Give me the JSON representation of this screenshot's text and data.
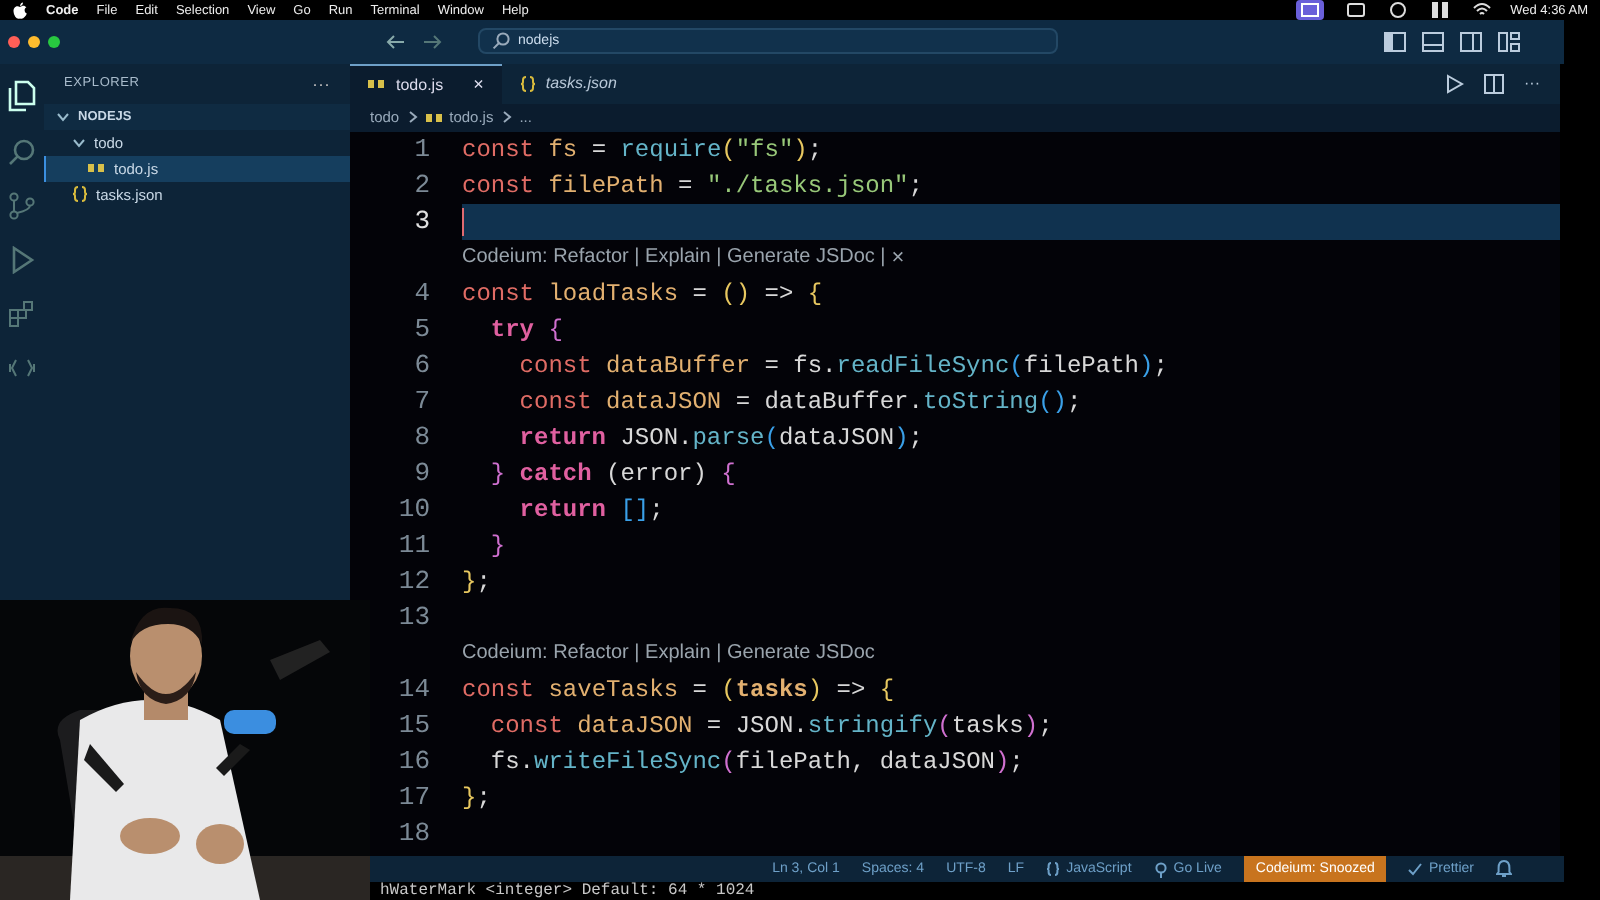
{
  "menu_bar": {
    "items": [
      {
        "label": "Code",
        "bold": true
      },
      {
        "label": "File",
        "bold": false
      },
      {
        "label": "Edit",
        "bold": false
      },
      {
        "label": "Selection",
        "bold": false
      },
      {
        "label": "View",
        "bold": false
      },
      {
        "label": "Go",
        "bold": false
      },
      {
        "label": "Run",
        "bold": false
      },
      {
        "label": "Terminal",
        "bold": false
      },
      {
        "label": "Window",
        "bold": false
      },
      {
        "label": "Help",
        "bold": false
      }
    ],
    "clock": "Wed 4:36 AM"
  },
  "title_bar": {
    "search": "nodejs"
  },
  "explorer": {
    "title": "EXPLORER",
    "more": "···",
    "root": {
      "label": "NODEJS",
      "expanded": true,
      "children": [
        {
          "label": "todo",
          "kind": "folder",
          "expanded": true,
          "selected": false,
          "children": [
            {
              "label": "todo.js",
              "kind": "js",
              "selected": true
            }
          ]
        },
        {
          "label": "tasks.json",
          "kind": "json",
          "selected": false
        }
      ]
    }
  },
  "tabs": [
    {
      "label": "todo.js",
      "kind": "js",
      "selected": true,
      "close": "×"
    },
    {
      "label": "tasks.json",
      "kind": "json",
      "selected": false
    }
  ],
  "breadcrumbs": [
    {
      "label": "todo",
      "kind": "folder"
    },
    {
      "label": "todo.js",
      "kind": "js"
    },
    {
      "label": "...",
      "kind": "more"
    }
  ],
  "editor": {
    "lines": [
      {
        "kind": "code",
        "number": "1",
        "current": false,
        "tokens": [
          {
            "kind": "kw",
            "text": "const"
          },
          {
            "kind": "var",
            "text": " fs"
          },
          {
            "kind": "op",
            "text": " = "
          },
          {
            "kind": "fn",
            "text": "require"
          },
          {
            "kind": "br",
            "text": "("
          },
          {
            "kind": "str",
            "text": "\"fs\""
          },
          {
            "kind": "br",
            "text": ")"
          },
          {
            "kind": "op",
            "text": ";"
          }
        ]
      },
      {
        "kind": "code",
        "number": "2",
        "current": false,
        "tokens": [
          {
            "kind": "kw",
            "text": "const"
          },
          {
            "kind": "var",
            "text": " filePath"
          },
          {
            "kind": "op",
            "text": " = "
          },
          {
            "kind": "str",
            "text": "\"./tasks.json\""
          },
          {
            "kind": "op",
            "text": ";"
          }
        ]
      },
      {
        "kind": "code",
        "number": "3",
        "current": true
      },
      {
        "kind": "lens",
        "text": "Codeium: Refactor | Explain | Generate JSDoc |",
        "close": "×"
      },
      {
        "kind": "code",
        "number": "4",
        "current": false,
        "tokens": [
          {
            "kind": "kw",
            "text": "const"
          },
          {
            "kind": "var",
            "text": " loadTasks"
          },
          {
            "kind": "op",
            "text": " = "
          },
          {
            "kind": "br",
            "text": "()"
          },
          {
            "kind": "op",
            "text": " => "
          },
          {
            "kind": "br",
            "text": "{"
          }
        ]
      },
      {
        "kind": "code",
        "number": "5",
        "current": false,
        "tokens": [
          {
            "kind": "ctl",
            "text": "  try"
          },
          {
            "kind": "br2",
            "text": " {"
          }
        ]
      },
      {
        "kind": "code",
        "number": "6",
        "current": false,
        "tokens": [
          {
            "kind": "kw",
            "text": "    const"
          },
          {
            "kind": "var",
            "text": " dataBuffer"
          },
          {
            "kind": "op",
            "text": " = "
          },
          {
            "kind": "plain",
            "text": "fs."
          },
          {
            "kind": "fn",
            "text": "readFileSync"
          },
          {
            "kind": "br3",
            "text": "("
          },
          {
            "kind": "plain",
            "text": "filePath"
          },
          {
            "kind": "br3",
            "text": ")"
          },
          {
            "kind": "op",
            "text": ";"
          }
        ]
      },
      {
        "kind": "code",
        "number": "7",
        "current": false,
        "tokens": [
          {
            "kind": "kw",
            "text": "    const"
          },
          {
            "kind": "var",
            "text": " dataJSON"
          },
          {
            "kind": "op",
            "text": " = "
          },
          {
            "kind": "plain",
            "text": "dataBuffer."
          },
          {
            "kind": "fn",
            "text": "toString"
          },
          {
            "kind": "br3",
            "text": "()"
          },
          {
            "kind": "op",
            "text": ";"
          }
        ]
      },
      {
        "kind": "code",
        "number": "8",
        "current": false,
        "tokens": [
          {
            "kind": "ctl",
            "text": "    return"
          },
          {
            "kind": "plain",
            "text": " JSON."
          },
          {
            "kind": "fn",
            "text": "parse"
          },
          {
            "kind": "br3",
            "text": "("
          },
          {
            "kind": "plain",
            "text": "dataJSON"
          },
          {
            "kind": "br3",
            "text": ")"
          },
          {
            "kind": "op",
            "text": ";"
          }
        ]
      },
      {
        "kind": "code",
        "number": "9",
        "current": false,
        "tokens": [
          {
            "kind": "br2",
            "text": "  }"
          },
          {
            "kind": "ctl",
            "text": " catch"
          },
          {
            "kind": "plain",
            "text": " (error) "
          },
          {
            "kind": "br2",
            "text": "{"
          }
        ]
      },
      {
        "kind": "code",
        "number": "10",
        "current": false,
        "tokens": [
          {
            "kind": "ctl",
            "text": "    return"
          },
          {
            "kind": "br3",
            "text": " []"
          },
          {
            "kind": "op",
            "text": ";"
          }
        ]
      },
      {
        "kind": "code",
        "number": "11",
        "current": false,
        "tokens": [
          {
            "kind": "br2",
            "text": "  }"
          }
        ]
      },
      {
        "kind": "code",
        "number": "12",
        "current": false,
        "tokens": [
          {
            "kind": "br",
            "text": "}"
          },
          {
            "kind": "op",
            "text": ";"
          }
        ]
      },
      {
        "kind": "code",
        "number": "13",
        "current": false
      },
      {
        "kind": "lens",
        "text": "Codeium: Refactor | Explain | Generate JSDoc"
      },
      {
        "kind": "code",
        "number": "14",
        "current": false,
        "tokens": [
          {
            "kind": "kw",
            "text": "const"
          },
          {
            "kind": "var",
            "text": " saveTasks"
          },
          {
            "kind": "op",
            "text": " = "
          },
          {
            "kind": "br",
            "text": "("
          },
          {
            "kind": "param",
            "text": "tasks"
          },
          {
            "kind": "br",
            "text": ")"
          },
          {
            "kind": "op",
            "text": " => "
          },
          {
            "kind": "br",
            "text": "{"
          }
        ]
      },
      {
        "kind": "code",
        "number": "15",
        "current": false,
        "tokens": [
          {
            "kind": "kw",
            "text": "  const"
          },
          {
            "kind": "var",
            "text": " dataJSON"
          },
          {
            "kind": "op",
            "text": " = "
          },
          {
            "kind": "plain",
            "text": "JSON."
          },
          {
            "kind": "fn",
            "text": "stringify"
          },
          {
            "kind": "br2",
            "text": "("
          },
          {
            "kind": "plain",
            "text": "tasks"
          },
          {
            "kind": "br2",
            "text": ")"
          },
          {
            "kind": "op",
            "text": ";"
          }
        ]
      },
      {
        "kind": "code",
        "number": "16",
        "current": false,
        "tokens": [
          {
            "kind": "plain",
            "text": "  fs."
          },
          {
            "kind": "fn",
            "text": "writeFileSync"
          },
          {
            "kind": "br2",
            "text": "("
          },
          {
            "kind": "plain",
            "text": "filePath, dataJSON"
          },
          {
            "kind": "br2",
            "text": ")"
          },
          {
            "kind": "op",
            "text": ";"
          }
        ]
      },
      {
        "kind": "code",
        "number": "17",
        "current": false,
        "tokens": [
          {
            "kind": "br",
            "text": "}"
          },
          {
            "kind": "op",
            "text": ";"
          }
        ]
      },
      {
        "kind": "code",
        "number": "18",
        "current": false
      }
    ]
  },
  "hover_hint": "hWaterMark <integer> Default: 64 * 1024",
  "status_bar": {
    "items": [
      {
        "label": "Ln 3, Col 1",
        "kind": "text"
      },
      {
        "label": "Spaces: 4",
        "kind": "text"
      },
      {
        "label": "UTF-8",
        "kind": "text"
      },
      {
        "label": "LF",
        "kind": "text"
      },
      {
        "label": "JavaScript",
        "kind": "language"
      },
      {
        "label": "Go Live",
        "kind": "live"
      },
      {
        "label": "Codeium: Snoozed",
        "kind": "warning"
      },
      {
        "label": "Prettier",
        "kind": "check"
      }
    ]
  }
}
